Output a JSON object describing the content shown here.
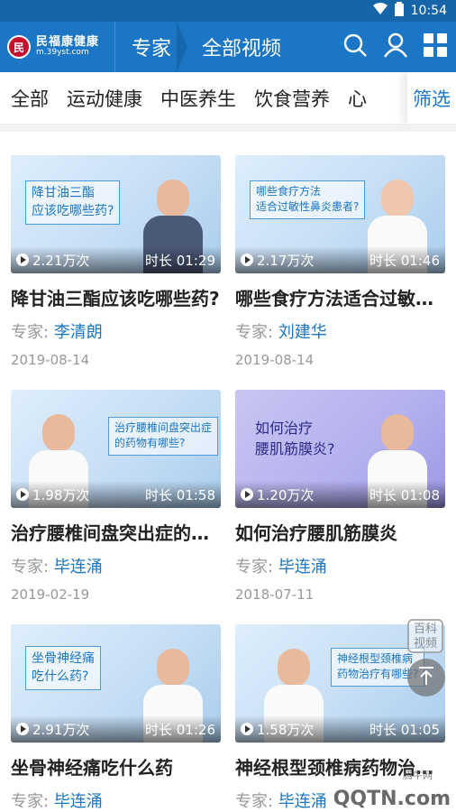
{
  "status_bar": {
    "time": "10:54"
  },
  "header": {
    "logo_text": "民福康健康",
    "logo_url": "m.39yst.com",
    "breadcrumb_1": "专家",
    "breadcrumb_2": "全部视频"
  },
  "tabs": {
    "items": [
      "全部",
      "运动健康",
      "中医养生",
      "饮食营养",
      "心"
    ],
    "filter_label": "筛选"
  },
  "videos": [
    {
      "caption": "降甘油三酯\n应该吃哪些药?",
      "views": "2.21万次",
      "duration": "时长 01:29",
      "title": "降甘油三酯应该吃哪些药?",
      "expert_label": "专家:",
      "expert_name": "李清朗",
      "date": "2019-08-14"
    },
    {
      "caption": "哪些食疗方法\n适合过敏性鼻炎患者?",
      "views": "2.17万次",
      "duration": "时长 01:46",
      "title": "哪些食疗方法适合过敏性鼻炎患者?",
      "expert_label": "专家:",
      "expert_name": "刘建华",
      "date": "2019-08-14"
    },
    {
      "caption": "治疗腰椎间盘突出症\n的药物有哪些?",
      "views": "1.98万次",
      "duration": "时长 01:58",
      "title": "治疗腰椎间盘突出症的药物有哪些?",
      "expert_label": "专家:",
      "expert_name": "毕连涌",
      "date": "2019-02-19"
    },
    {
      "caption": "如何治疗\n腰肌筋膜炎?",
      "views": "1.20万次",
      "duration": "时长 01:08",
      "title": "如何治疗腰肌筋膜炎",
      "expert_label": "专家:",
      "expert_name": "毕连涌",
      "date": "2018-07-11"
    },
    {
      "caption": "坐骨神经痛\n吃什么药?",
      "views": "2.91万次",
      "duration": "时长 01:26",
      "title": "坐骨神经痛吃什么药",
      "expert_label": "专家:",
      "expert_name": "毕连涌",
      "date": ""
    },
    {
      "caption": "神经根型颈椎病\n药物治疗有哪些?",
      "views": "1.58万次",
      "duration": "时长 01:05",
      "title": "神经根型颈椎病药物治疗有哪些?",
      "expert_label": "专家:",
      "expert_name": "毕连涌",
      "date": ""
    }
  ],
  "floating": {
    "baike_label": "百科\n视频"
  },
  "watermark": {
    "text": "QQTN.com",
    "small": "腾牛网"
  },
  "colors": {
    "brand_blue": "#1b76c5",
    "status_blue": "#1565a8",
    "link_blue": "#1b76c5"
  }
}
